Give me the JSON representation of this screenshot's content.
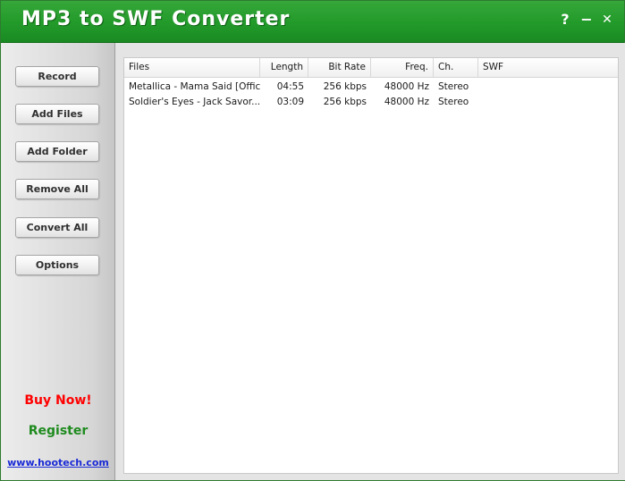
{
  "window": {
    "title": "MP3 to SWF Converter",
    "help_glyph": "?",
    "minimize_glyph": "−",
    "close_glyph": "✕"
  },
  "sidebar": {
    "buttons": [
      {
        "label": "Record"
      },
      {
        "label": "Add Files"
      },
      {
        "label": "Add Folder"
      },
      {
        "label": "Remove All"
      },
      {
        "label": "Convert All"
      },
      {
        "label": "Options"
      }
    ],
    "buy_now": "Buy Now!",
    "register": "Register",
    "website": "www.hootech.com"
  },
  "file_list": {
    "columns": [
      "Files",
      "Length",
      "Bit Rate",
      "Freq.",
      "Ch.",
      "SWF"
    ],
    "rows": [
      {
        "file": "Metallica - Mama Said [Offic...",
        "length": "04:55",
        "bitrate": "256 kbps",
        "freq": "48000 Hz",
        "ch": "Stereo",
        "swf": ""
      },
      {
        "file": "Soldier's Eyes - Jack Savor...",
        "length": "03:09",
        "bitrate": "256 kbps",
        "freq": "48000 Hz",
        "ch": "Stereo",
        "swf": ""
      }
    ]
  },
  "colors": {
    "titlebar_green": "#229a2a",
    "buy_now_red": "#ff0000",
    "register_green": "#1f8b1f",
    "link_blue": "#1a2ad6"
  }
}
